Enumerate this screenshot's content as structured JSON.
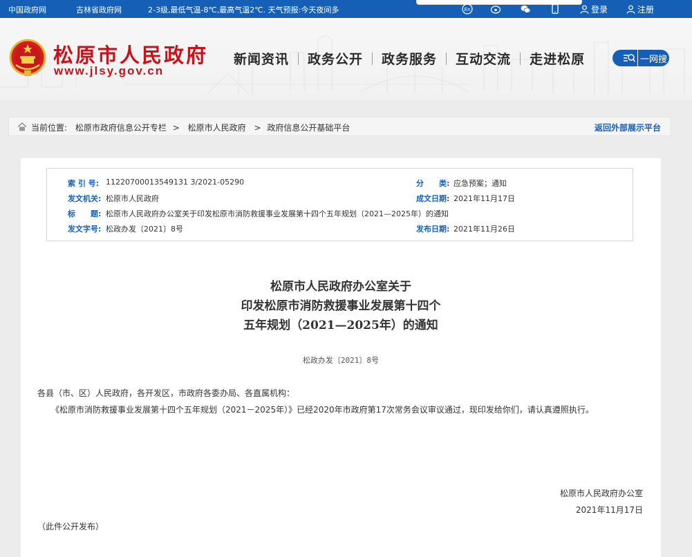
{
  "topbar": {
    "link_gov": "中国政府网",
    "link_jilin": "吉林省政府网",
    "weather": "2-3级,最低气温-8℃,最高气温2℃.   天气预报:今天夜间多",
    "login": "登录",
    "register": "注册"
  },
  "header": {
    "site_title": "松原市人民政府",
    "site_url": "www.jlsy.gov.cn",
    "nav": [
      "新闻资讯",
      "政务公开",
      "政务服务",
      "互动交流",
      "走进松原"
    ],
    "search_label": "一网搜"
  },
  "breadcrumb": {
    "prefix": "当前位置:",
    "items": [
      "松原市政府信息公开专栏",
      ">",
      "松原市人民政府",
      ">",
      "政府信息公开基础平台"
    ],
    "back_link": "返回外部展示平台"
  },
  "meta": {
    "index_label": "索 引 号:",
    "index_value": "11220700013549131 3/2021-05290",
    "category_label": "分　　类:",
    "category_value": "应急预案；通知",
    "issuer_label": "发文机关:",
    "issuer_value": "松原市人民政府",
    "date_made_label": "成文日期:",
    "date_made_value": "2021年11月17日",
    "title_label": "标　　题:",
    "title_value": "松原市人民政府办公室关于印发松原市消防救援事业发展第十四个五年规划（2021—2025年）的通知",
    "docno_label": "发文字号:",
    "docno_value": "松政办发〔2021〕8号",
    "pub_date_label": "发布日期:",
    "pub_date_value": "2021年11月26日"
  },
  "document": {
    "title_line1": "松原市人民政府办公室关于",
    "title_line2": "印发松原市消防救援事业发展第十四个",
    "title_line3": "五年规划（2021—2025年）的通知",
    "doc_number": "松政办发〔2021〕8号",
    "salutation": "各县（市、区）人民政府，各开发区，市政府各委办局、各直属机构：",
    "body": "《松原市消防救援事业发展第十四个五年规划（2021－2025年）》已经2020年市政府第17次常务会议审议通过，现印发给你们，请认真遵照执行。",
    "signature_org": "松原市人民政府办公室",
    "signature_date": "2021年11月17日",
    "note": "（此件公开发布）"
  },
  "colors": {
    "brand_blue": "#1560b6",
    "title_red": "#c8121b"
  }
}
